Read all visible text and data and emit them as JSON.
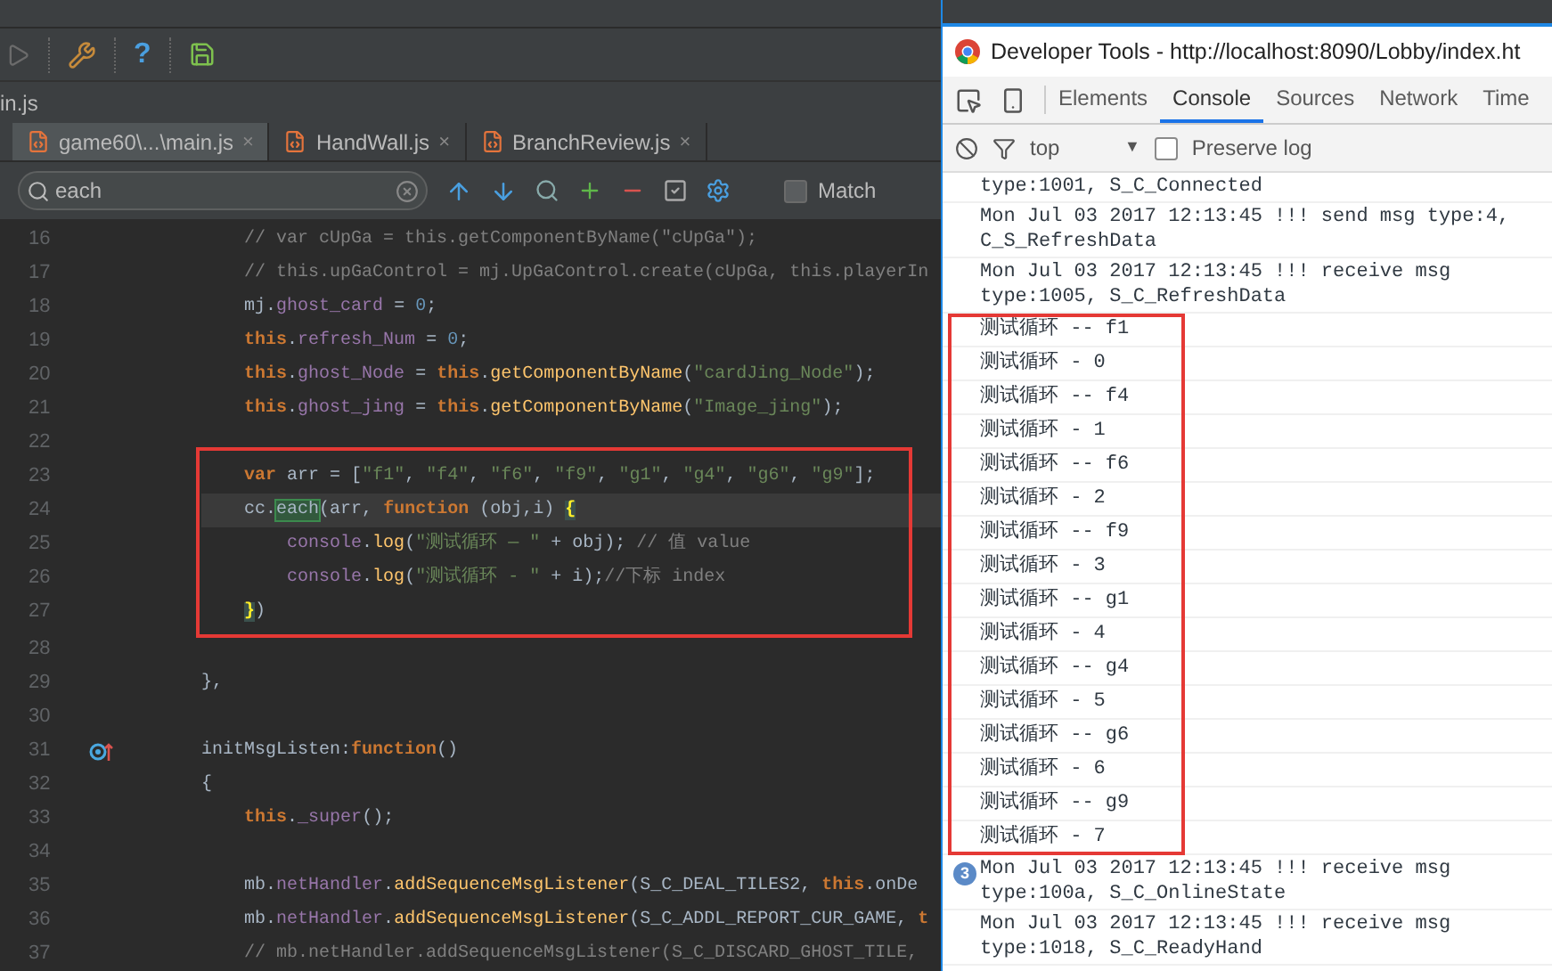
{
  "ide": {
    "toolbar": {
      "help_label": "?"
    },
    "breadcrumb": "in.js",
    "tabs": [
      {
        "label": "game60\\...\\main.js",
        "close": "×",
        "selected": true
      },
      {
        "label": "HandWall.js",
        "close": "×",
        "selected": false
      },
      {
        "label": "BranchReview.js",
        "close": "×",
        "selected": false
      }
    ],
    "search": {
      "value": "each",
      "match_case": {
        "label": "Match",
        "checked": false
      }
    },
    "code": {
      "lines_before": [
        {
          "n": "16",
          "tokens": [
            {
              "kind": "cm",
              "text": "    // var cUpGa = this.getComponentByName(\"cUpGa\");"
            }
          ]
        },
        {
          "n": "17",
          "tokens": [
            {
              "kind": "cm",
              "text": "    // this.upGaControl = mj.UpGaControl.create(cUpGa, this.playerIn"
            }
          ]
        },
        {
          "n": "18",
          "tokens": [
            {
              "kind": "pl",
              "text": "    mj."
            },
            {
              "kind": "pr",
              "text": "ghost_card"
            },
            {
              "kind": "pl",
              "text": " = "
            },
            {
              "kind": "nu",
              "text": "0"
            },
            {
              "kind": "pl",
              "text": ";"
            }
          ]
        },
        {
          "n": "19",
          "tokens": [
            {
              "kind": "kw",
              "text": "    this"
            },
            {
              "kind": "pl",
              "text": "."
            },
            {
              "kind": "pr",
              "text": "refresh_Num"
            },
            {
              "kind": "pl",
              "text": " = "
            },
            {
              "kind": "nu",
              "text": "0"
            },
            {
              "kind": "pl",
              "text": ";"
            }
          ]
        },
        {
          "n": "20",
          "tokens": [
            {
              "kind": "kw",
              "text": "    this"
            },
            {
              "kind": "pl",
              "text": "."
            },
            {
              "kind": "pr",
              "text": "ghost_Node"
            },
            {
              "kind": "pl",
              "text": " = "
            },
            {
              "kind": "kw",
              "text": "this"
            },
            {
              "kind": "pl",
              "text": "."
            },
            {
              "kind": "fn",
              "text": "getComponentByName"
            },
            {
              "kind": "pl",
              "text": "("
            },
            {
              "kind": "st",
              "text": "\"cardJing_Node\""
            },
            {
              "kind": "pl",
              "text": ");"
            }
          ]
        },
        {
          "n": "21",
          "tokens": [
            {
              "kind": "kw",
              "text": "    this"
            },
            {
              "kind": "pl",
              "text": "."
            },
            {
              "kind": "pr",
              "text": "ghost_jing"
            },
            {
              "kind": "pl",
              "text": " = "
            },
            {
              "kind": "kw",
              "text": "this"
            },
            {
              "kind": "pl",
              "text": "."
            },
            {
              "kind": "fn",
              "text": "getComponentByName"
            },
            {
              "kind": "pl",
              "text": "("
            },
            {
              "kind": "st",
              "text": "\"Image_jing\""
            },
            {
              "kind": "pl",
              "text": ");"
            }
          ]
        },
        {
          "n": "22"
        }
      ],
      "boxed_lines": [
        {
          "n": "23",
          "tokens": [
            {
              "kind": "kw",
              "text": "    var"
            },
            {
              "kind": "pl",
              "text": " arr = ["
            },
            {
              "kind": "st",
              "text": "\"f1\""
            },
            {
              "kind": "pl",
              "text": ", "
            },
            {
              "kind": "st",
              "text": "\"f4\""
            },
            {
              "kind": "pl",
              "text": ", "
            },
            {
              "kind": "st",
              "text": "\"f6\""
            },
            {
              "kind": "pl",
              "text": ", "
            },
            {
              "kind": "st",
              "text": "\"f9\""
            },
            {
              "kind": "pl",
              "text": ", "
            },
            {
              "kind": "st",
              "text": "\"g1\""
            },
            {
              "kind": "pl",
              "text": ", "
            },
            {
              "kind": "st",
              "text": "\"g4\""
            },
            {
              "kind": "pl",
              "text": ", "
            },
            {
              "kind": "st",
              "text": "\"g6\""
            },
            {
              "kind": "pl",
              "text": ", "
            },
            {
              "kind": "st",
              "text": "\"g9\""
            },
            {
              "kind": "pl",
              "text": "];"
            }
          ]
        },
        {
          "n": "24",
          "current": true,
          "tokens": [
            {
              "kind": "pl",
              "text": "    cc."
            },
            {
              "kind": "mt",
              "text": "each"
            },
            {
              "kind": "pl",
              "text": "(arr, "
            },
            {
              "kind": "kw",
              "text": "function"
            },
            {
              "kind": "pl",
              "text": " (obj,i) "
            },
            {
              "kind": "br",
              "text": "{"
            }
          ]
        },
        {
          "n": "25",
          "tokens": [
            {
              "kind": "pr",
              "text": "        console"
            },
            {
              "kind": "pl",
              "text": "."
            },
            {
              "kind": "fn",
              "text": "log"
            },
            {
              "kind": "pl",
              "text": "("
            },
            {
              "kind": "st",
              "text": "\"测试循环 — \""
            },
            {
              "kind": "pl",
              "text": " + obj); "
            },
            {
              "kind": "cm",
              "text": "// 值 value"
            }
          ]
        },
        {
          "n": "26",
          "tokens": [
            {
              "kind": "pr",
              "text": "        console"
            },
            {
              "kind": "pl",
              "text": "."
            },
            {
              "kind": "fn",
              "text": "log"
            },
            {
              "kind": "pl",
              "text": "("
            },
            {
              "kind": "st",
              "text": "\"测试循环 - \""
            },
            {
              "kind": "pl",
              "text": " + i);"
            },
            {
              "kind": "cm",
              "text": "//下标 index"
            }
          ]
        },
        {
          "n": "27",
          "tokens": [
            {
              "kind": "br",
              "text": "    }"
            },
            {
              "kind": "pl",
              "text": ")"
            }
          ]
        }
      ],
      "lines_after": [
        {
          "n": "28"
        },
        {
          "n": "29",
          "tokens": [
            {
              "kind": "pl",
              "text": "},"
            }
          ]
        },
        {
          "n": "30"
        },
        {
          "n": "31",
          "override_marker": true,
          "tokens": [
            {
              "kind": "pl",
              "text": "initMsgListen:"
            },
            {
              "kind": "kw",
              "text": "function"
            },
            {
              "kind": "pl",
              "text": "()"
            }
          ]
        },
        {
          "n": "32",
          "tokens": [
            {
              "kind": "pl",
              "text": "{"
            }
          ]
        },
        {
          "n": "33",
          "tokens": [
            {
              "kind": "kw",
              "text": "    this"
            },
            {
              "kind": "pl",
              "text": "."
            },
            {
              "kind": "pr",
              "text": "_super"
            },
            {
              "kind": "pl",
              "text": "();"
            }
          ]
        },
        {
          "n": "34"
        },
        {
          "n": "35",
          "tokens": [
            {
              "kind": "pl",
              "text": "    mb."
            },
            {
              "kind": "pr",
              "text": "netHandler"
            },
            {
              "kind": "pl",
              "text": "."
            },
            {
              "kind": "fn",
              "text": "addSequenceMsgListener"
            },
            {
              "kind": "pl",
              "text": "(S_C_DEAL_TILES2, "
            },
            {
              "kind": "kw",
              "text": "this"
            },
            {
              "kind": "pl",
              "text": ".onDe"
            }
          ]
        },
        {
          "n": "36",
          "tokens": [
            {
              "kind": "pl",
              "text": "    mb."
            },
            {
              "kind": "pr",
              "text": "netHandler"
            },
            {
              "kind": "pl",
              "text": "."
            },
            {
              "kind": "fn",
              "text": "addSequenceMsgListener"
            },
            {
              "kind": "pl",
              "text": "(S_C_ADDL_REPORT_CUR_GAME, "
            },
            {
              "kind": "kw",
              "text": "t"
            }
          ]
        },
        {
          "n": "37",
          "tokens": [
            {
              "kind": "cm",
              "text": "    // mb.netHandler.addSequenceMsgListener(S_C_DISCARD_GHOST_TILE,"
            }
          ]
        }
      ]
    }
  },
  "devtools": {
    "title": "Developer Tools - http://localhost:8090/Lobby/index.ht",
    "tabs": [
      {
        "label": "Elements",
        "selected": false
      },
      {
        "label": "Console",
        "selected": true
      },
      {
        "label": "Sources",
        "selected": false
      },
      {
        "label": "Network",
        "selected": false
      },
      {
        "label": "Time",
        "selected": false
      }
    ],
    "filter": {
      "context": "top",
      "caret": "▼",
      "preserve_log": {
        "label": "Preserve log",
        "checked": false
      }
    },
    "console": {
      "entries_before": [
        {
          "lines": [
            "type:1001, S_C_Connected"
          ]
        },
        {
          "lines": [
            "Mon Jul 03 2017 12:13:45 !!! send msg type:4,",
            "C_S_RefreshData"
          ]
        },
        {
          "lines": [
            "Mon Jul 03 2017 12:13:45 !!! receive msg",
            "type:1005, S_C_RefreshData"
          ]
        }
      ],
      "boxed_entries": [
        "测试循环 -- f1",
        "测试循环 - 0",
        "测试循环 -- f4",
        "测试循环 - 1",
        "测试循环 -- f6",
        "测试循环 - 2",
        "测试循环 -- f9",
        "测试循环 - 3",
        "测试循环 -- g1",
        "测试循环 - 4",
        "测试循环 -- g4",
        "测试循环 - 5",
        "测试循环 -- g6",
        "测试循环 - 6",
        "测试循环 -- g9",
        "测试循环 - 7"
      ],
      "entries_after": [
        {
          "count": "3",
          "lines": [
            "Mon Jul 03 2017 12:13:45 !!! receive msg",
            "type:100a, S_C_OnlineState"
          ]
        },
        {
          "lines": [
            "Mon Jul 03 2017 12:13:45 !!! receive msg",
            "type:1018, S_C_ReadyHand"
          ]
        }
      ]
    }
  }
}
